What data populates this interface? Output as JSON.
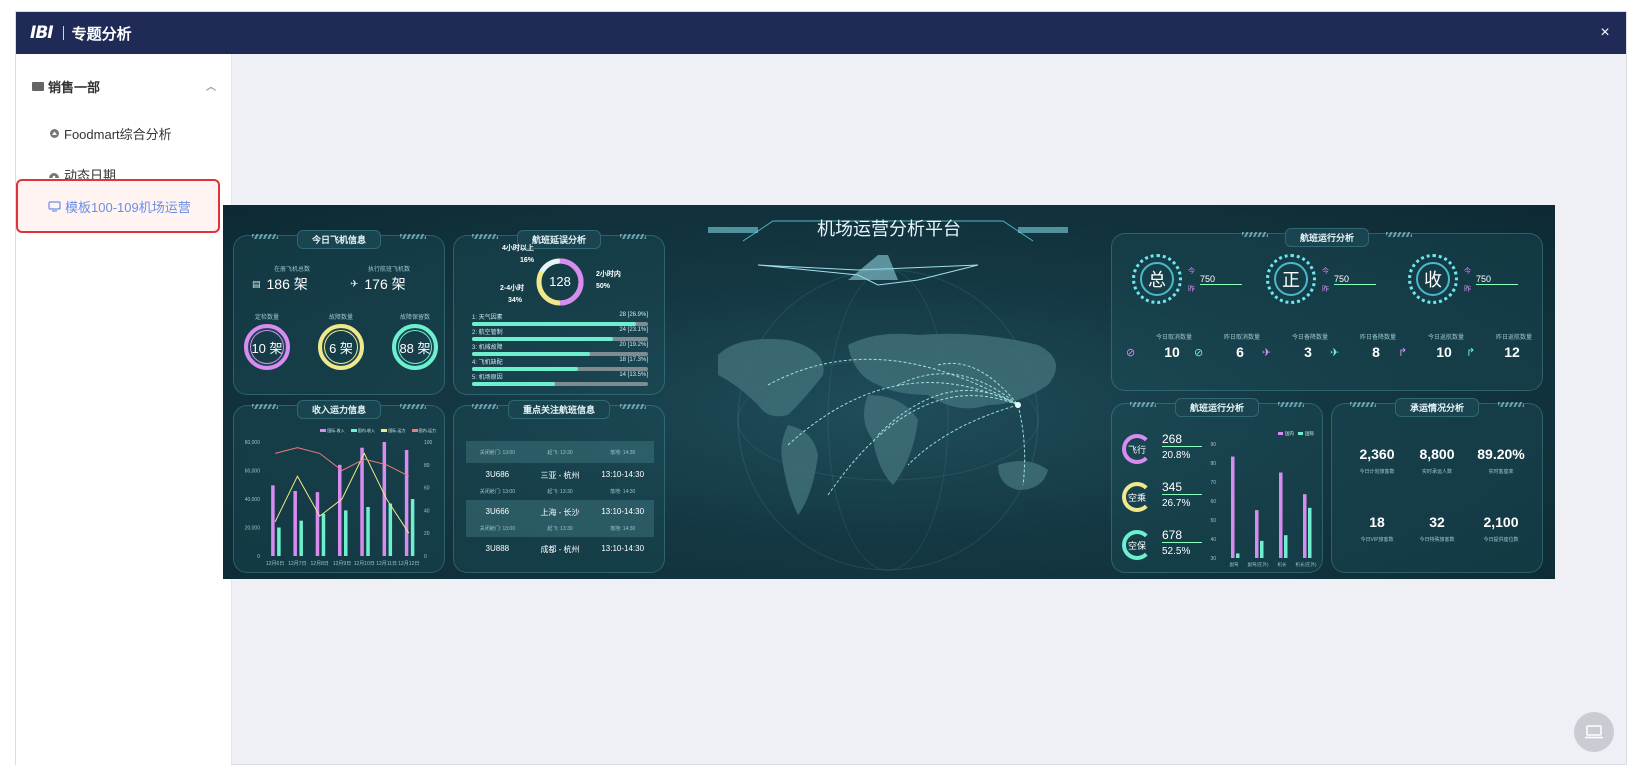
{
  "window": {
    "logo": "IBI",
    "title": "专题分析",
    "close": "×"
  },
  "sidebar": {
    "folder": "销售一部",
    "items": [
      {
        "label": "Foodmart综合分析",
        "icon": "circle-icon"
      },
      {
        "label": "动态日期",
        "icon": "gauge-icon"
      },
      {
        "label": "模板100-109机场运营",
        "icon": "monitor-icon",
        "active": true
      }
    ]
  },
  "dashboard": {
    "title": "机场运营分析平台",
    "today_aircraft": {
      "title": "今日飞机信息",
      "in_service_label": "在册飞机总数",
      "in_service_value": "186 架",
      "flying_label": "执行航班飞机数",
      "flying_value": "176 架",
      "rings": [
        {
          "label": "定检数量",
          "value": "10 架",
          "color": "#d98cf0"
        },
        {
          "label": "故障数量",
          "value": "6 架",
          "color": "#f0e88a"
        },
        {
          "label": "故障保留数",
          "value": "88 架",
          "color": "#6ef0cf"
        }
      ]
    },
    "delay": {
      "title": "航班延误分析",
      "center": "128",
      "segments": [
        {
          "label": "4小时以上",
          "pct": "16%"
        },
        {
          "label": "2小时内",
          "pct": "50%"
        },
        {
          "label": "2-4小时",
          "pct": "34%"
        }
      ],
      "reasons": [
        {
          "label": "1: 天气因素",
          "value": "28 [26.9%]",
          "fraction": 0.93
        },
        {
          "label": "2: 航空管制",
          "value": "24 [23.1%]",
          "fraction": 0.8
        },
        {
          "label": "3: 机械故障",
          "value": "20 [19.2%]",
          "fraction": 0.67
        },
        {
          "label": "4: 飞机缺配",
          "value": "18 [17.3%]",
          "fraction": 0.6
        },
        {
          "label": "5: 机场原因",
          "value": "14 [13.5%]",
          "fraction": 0.47
        }
      ]
    },
    "revenue": {
      "title": "收入运力信息",
      "legend": [
        "国际-收入",
        "国内-收入",
        "国际-运力",
        "国内-运力"
      ],
      "y_left": [
        "80,000",
        "60,000",
        "40,000",
        "20,000",
        "0"
      ],
      "y_right": [
        "100",
        "80",
        "60",
        "40",
        "20",
        "0"
      ],
      "categories": [
        "12月6日",
        "12月7日",
        "12月8日",
        "12月9日",
        "12月10日",
        "12月11日",
        "12月12日"
      ]
    },
    "flights": {
      "title": "重点关注航班信息",
      "rows": [
        {
          "no": "",
          "route": "",
          "time": "",
          "gate": "关闭舱门: 13:00",
          "dep": "起飞: 13:30",
          "arr": "落地: 14:30"
        },
        {
          "no": "3U686",
          "route": "三亚 - 杭州",
          "time": "13:10-14:30",
          "gate": "关闭舱门: 13:00",
          "dep": "起飞: 13:30",
          "arr": "落地: 14:30"
        },
        {
          "no": "3U666",
          "route": "上海 - 长沙",
          "time": "13:10-14:30",
          "gate": "关闭舱门: 13:00",
          "dep": "起飞: 13:30",
          "arr": "落地: 14:30"
        },
        {
          "no": "3U888",
          "route": "成都 - 杭州",
          "time": "13:10-14:30",
          "gate": "",
          "dep": "",
          "arr": ""
        }
      ]
    },
    "ops": {
      "title": "航班运行分析",
      "dials": [
        {
          "char": "总",
          "today": "今",
          "yesterday": "昨",
          "value": "750"
        },
        {
          "char": "正",
          "today": "今",
          "yesterday": "昨",
          "value": "750"
        },
        {
          "char": "收",
          "today": "今",
          "yesterday": "昨",
          "value": "750"
        }
      ],
      "counts": [
        {
          "label": "今日取消数量",
          "value": "10"
        },
        {
          "label": "昨日取消数量",
          "value": "6"
        },
        {
          "label": "今日备降数量",
          "value": "3"
        },
        {
          "label": "昨日备降数量",
          "value": "8"
        },
        {
          "label": "今日返航数量",
          "value": "10"
        },
        {
          "label": "昨日返航数量",
          "value": "12"
        }
      ]
    },
    "ops2": {
      "title": "航班运行分析",
      "items": [
        {
          "char": "飞行",
          "value": "268",
          "pct": "20.8%",
          "color": "#d98cf0"
        },
        {
          "char": "空乘",
          "value": "345",
          "pct": "26.7%",
          "color": "#f0e88a"
        },
        {
          "char": "空保",
          "value": "678",
          "pct": "52.5%",
          "color": "#6ef0cf"
        }
      ],
      "legend": [
        "国内",
        "国际"
      ],
      "y_axis": [
        "90",
        "80",
        "70",
        "60",
        "50",
        "40",
        "30"
      ],
      "categories": [
        "副驾",
        "副驾(在外)",
        "机长",
        "机长(在外)"
      ]
    },
    "passenger": {
      "title": "承运情况分析",
      "stats": [
        {
          "value": "2,360",
          "label": "今日计划旅客数"
        },
        {
          "value": "8,800",
          "label": "实时承运人数"
        },
        {
          "value": "89.20%",
          "label": "实时客座率"
        },
        {
          "value": "18",
          "label": "今日VIP旅客数"
        },
        {
          "value": "32",
          "label": "今日特殊旅客数"
        },
        {
          "value": "2,100",
          "label": "今日提供座位数"
        }
      ]
    }
  }
}
